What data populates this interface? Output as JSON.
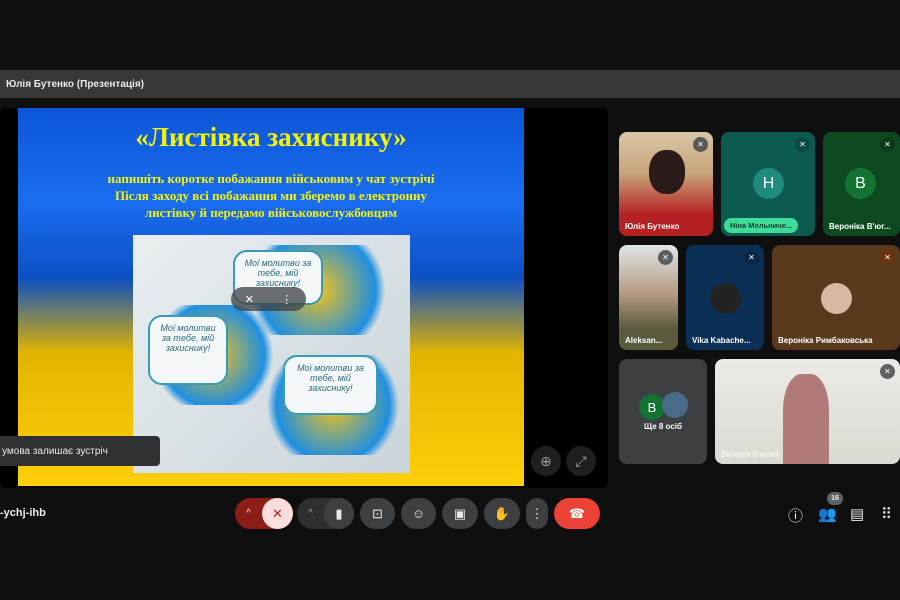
{
  "presentation": {
    "title": "Юлія Бутенко (Презентація)",
    "slide": {
      "heading": "«Листівка захиснику»",
      "line1": "напишіть коротке побажання військовим у чат зустрічі",
      "line2": "Після заходу всі побажання ми зберемо в електронну",
      "line3": "листівку й передамо військовослужбовцям",
      "card1": "Мої молитви за тебе, мій захиснику!",
      "card2": "Мої молитви за тебе, мій захиснику!",
      "card3": "Мої молитви за тебе, мій захиснику!"
    }
  },
  "toast": "умова залишає зустріч",
  "participants": [
    {
      "name": "Юлія Бутенко"
    },
    {
      "name": "Ніна Мельниче...",
      "initial": "Н"
    },
    {
      "name": "Вероніка В'юг...",
      "initial": "В"
    },
    {
      "name": "Aleksan..."
    },
    {
      "name": "Vika Kabache..."
    },
    {
      "name": "Вероніка Римбаковська"
    },
    {
      "name": "Вікторія В'югіна"
    }
  ],
  "more_people": {
    "label": "Ще 8 осіб",
    "initial": "В"
  },
  "meeting_code": "-ychj-ihb",
  "people_count": "16",
  "colors": {
    "end_call": "#ea4335",
    "mic_off": "#f9dedc",
    "accent": "#8ab4f8"
  }
}
